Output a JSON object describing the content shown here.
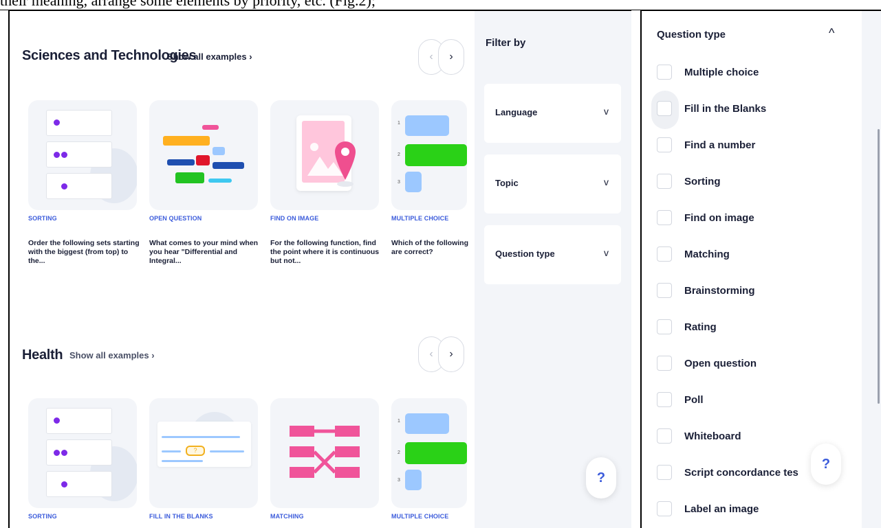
{
  "document_text": "their meaning, arrange some elements by priority, etc. (Fig.2);",
  "sections": [
    {
      "title": "Sciences and Technologies",
      "show_all": "Show all examples ›",
      "cards": [
        {
          "type": "SORTING",
          "description": "Order the following sets starting with the biggest (from top) to the..."
        },
        {
          "type": "OPEN QUESTION",
          "description": "What comes to your mind when you hear \"Differential and Integral..."
        },
        {
          "type": "FIND ON IMAGE",
          "description": "For the following function, find the point where it is continuous but not..."
        },
        {
          "type": "MULTIPLE CHOICE",
          "description": "Which of the following are correct?"
        }
      ]
    },
    {
      "title": "Health",
      "show_all": "Show all examples ›",
      "cards": [
        {
          "type": "SORTING",
          "description": ""
        },
        {
          "type": "FILL IN THE BLANKS",
          "description": ""
        },
        {
          "type": "MATCHING",
          "description": ""
        },
        {
          "type": "MULTIPLE CHOICE",
          "description": ""
        }
      ]
    }
  ],
  "nav": {
    "prev": "‹",
    "next": "›"
  },
  "filter": {
    "title": "Filter by",
    "groups": [
      {
        "label": "Language",
        "chevron": "v"
      },
      {
        "label": "Topic",
        "chevron": "v"
      },
      {
        "label": "Question type",
        "chevron": "v"
      }
    ]
  },
  "help": {
    "label": "?"
  },
  "question_type_panel": {
    "header": "Question type",
    "caret": "^",
    "items": [
      "Multiple choice",
      "Fill in the Blanks",
      "Find a number",
      "Sorting",
      "Find on image",
      "Matching",
      "Brainstorming",
      "Rating",
      "Open question",
      "Poll",
      "Whiteboard",
      "Script concordance tes",
      "Label an image"
    ]
  },
  "colors": {
    "accent_blue": "#3b5bdb",
    "accent_purple": "#7d2ae8",
    "panel_bg": "#f3f5f9",
    "text_dark": "#1a1f36"
  }
}
